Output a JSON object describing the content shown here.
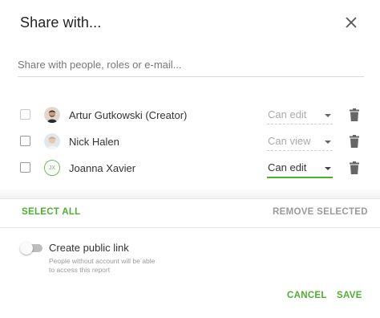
{
  "dialog": {
    "title": "Share with...",
    "search_placeholder": "Share with people, roles or e-mail..."
  },
  "members": [
    {
      "name": "Artur Gutkowski (Creator)",
      "permission": "Can edit",
      "avatar": "photo",
      "selected": false
    },
    {
      "name": "Nick Halen",
      "permission": "Can view",
      "avatar": "photo",
      "selected": false
    },
    {
      "name": "Joanna Xavier",
      "permission": "Can edit",
      "avatar": "initials",
      "initials": "JX",
      "selected": false
    }
  ],
  "actions": {
    "select_all": "SELECT ALL",
    "remove_selected": "REMOVE SELECTED"
  },
  "public_link": {
    "label": "Create public link",
    "helper": "People without account will be able to access this report",
    "enabled": false
  },
  "footer": {
    "cancel": "CANCEL",
    "save": "SAVE"
  },
  "colors": {
    "accent": "#4caf2e",
    "disabled": "#9a9a9a"
  }
}
